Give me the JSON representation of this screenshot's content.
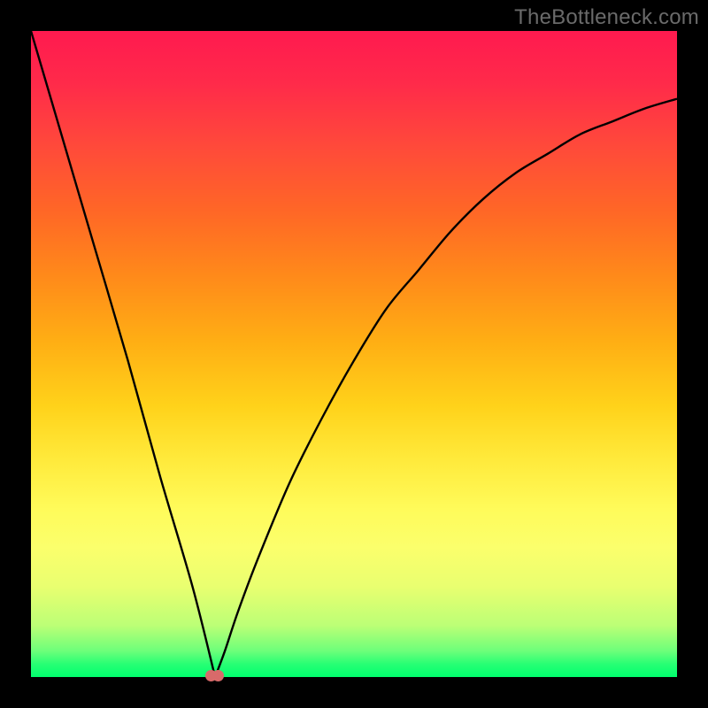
{
  "watermark": "TheBottleneck.com",
  "colors": {
    "line": "#000000",
    "dot": "#d86a6a",
    "frame": "#000000"
  },
  "chart_data": {
    "type": "line",
    "title": "",
    "xlabel": "",
    "ylabel": "",
    "xlim": [
      0,
      1
    ],
    "ylim": [
      0,
      1
    ],
    "note": "No axis tick labels are visible; values are normalized 0–1 fractions of the plot area. y≈1 at top (red), y≈0 at bottom (green). x≈0 at left edge.",
    "series": [
      {
        "name": "bottleneck-curve",
        "x": [
          0.0,
          0.05,
          0.1,
          0.15,
          0.2,
          0.25,
          0.285,
          0.3,
          0.32,
          0.35,
          0.4,
          0.45,
          0.5,
          0.55,
          0.6,
          0.65,
          0.7,
          0.75,
          0.8,
          0.85,
          0.9,
          0.95,
          1.0
        ],
        "y": [
          1.0,
          0.83,
          0.66,
          0.49,
          0.31,
          0.14,
          0.0,
          0.04,
          0.1,
          0.18,
          0.3,
          0.4,
          0.49,
          0.57,
          0.63,
          0.69,
          0.74,
          0.78,
          0.81,
          0.84,
          0.86,
          0.88,
          0.895
        ]
      }
    ],
    "marker": {
      "name": "minimum-point",
      "x": 0.285,
      "y": 0.0
    }
  }
}
